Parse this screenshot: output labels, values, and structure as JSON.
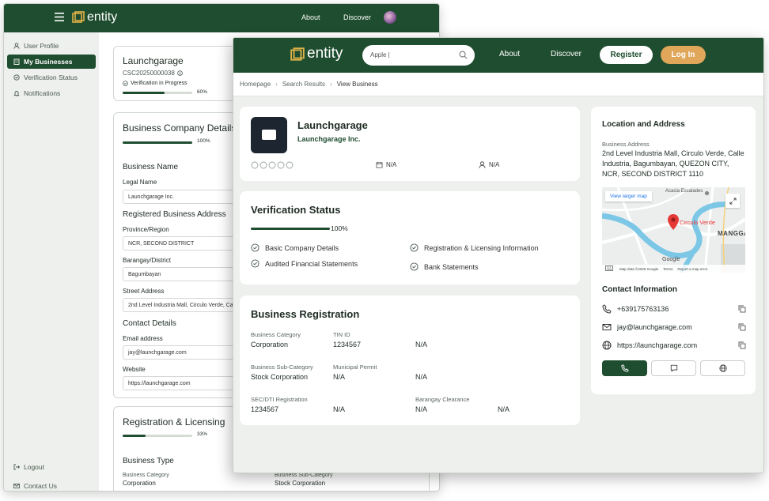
{
  "back_window": {
    "brand": "entity",
    "nav": {
      "about": "About",
      "discover": "Discover"
    },
    "sidebar": {
      "items": [
        {
          "label": "User Profile",
          "icon": "user-icon"
        },
        {
          "label": "My Businesses",
          "icon": "building-icon"
        },
        {
          "label": "Verification Status",
          "icon": "shield-icon"
        },
        {
          "label": "Notifications",
          "icon": "bell-icon"
        }
      ],
      "logout": "Logout",
      "contact_us": "Contact Us"
    },
    "business": {
      "name": "Launchgarage",
      "code": "CSC20250000038",
      "status": "Verification in Progress",
      "progress_pct": 60,
      "progress_label": "60%"
    },
    "company_details": {
      "title": "Business Company Details",
      "progress_pct": 100,
      "progress_label": "100%",
      "business_name_heading": "Business Name",
      "legal_name_label": "Legal Name",
      "legal_name_value": "Launchgarage Inc.",
      "address_heading": "Registered Business Address",
      "province_label": "Province/Region",
      "province_value": "NCR, SECOND DISTRICT",
      "barangay_label": "Barangay/District",
      "barangay_value": "Bagumbayan",
      "street_label": "Street Address",
      "street_value": "2nd Level Industria Mall, Circulo Verde, Ca",
      "contact_heading": "Contact Details",
      "email_label": "Email address",
      "email_value": "jay@launchgarage.com",
      "website_label": "Website",
      "website_value": "https://launchgarage.com"
    },
    "licensing": {
      "title": "Registration & Licensing",
      "progress_pct": 33,
      "progress_label": "33%",
      "type_heading": "Business Type",
      "category_label": "Business Category",
      "category_value": "Corporation",
      "subcategory_label": "Business Sub-Category",
      "subcategory_value": "Stock Corporation"
    }
  },
  "front_window": {
    "brand": "entity",
    "search": {
      "value": "Apple |"
    },
    "nav": {
      "about": "About",
      "discover": "Discover",
      "register": "Register",
      "login": "Log In"
    },
    "breadcrumb": [
      "Homepage",
      "Search Results",
      "View Business"
    ],
    "business": {
      "name": "Launchgarage",
      "legal_name": "Launchgarage Inc.",
      "rating": 0,
      "date": "N/A",
      "person": "N/A"
    },
    "verification": {
      "title": "Verification Status",
      "progress_pct": 100,
      "progress_label": "100%",
      "items": [
        "Basic Company Details",
        "Registration & Licensing Information",
        "Audited Financial Statements",
        "Bank Statements"
      ]
    },
    "registration": {
      "title": "Business Registration",
      "category_label": "Business Category",
      "category_value": "Corporation",
      "tin_label": "TIN ID",
      "tin_value": "1234567",
      "col3_row1_value": "N/A",
      "subcategory_label": "Business Sub-Category",
      "subcategory_value": "Stock Corporation",
      "permit_label": "Municipal Permit",
      "permit_value": "N/A",
      "col3_row2_value": "N/A",
      "sec_label": "SEC/DTI Registration",
      "sec_value": "1234567",
      "col2_row3_value": "N/A",
      "clearance_label": "Barangay Clearance",
      "clearance_value": "N/A",
      "col4_row3_value": "N/A"
    },
    "location": {
      "title": "Location and Address",
      "address_label": "Business Address",
      "address_value": "2nd Level Industria Mall, Circulo Verde, Calle Industria, Bagumbayan, QUEZON CITY, NCR, SECOND DISTRICT 1110",
      "map": {
        "view_larger": "View larger map",
        "place": "Circulo Verde",
        "area": "MANGGAH",
        "street": "Acacia Escalades",
        "google": "Google",
        "footer": [
          "Map data ©2025 Google",
          "Terms",
          "Report a map error"
        ]
      }
    },
    "contact": {
      "title": "Contact Information",
      "phone": "+639175763136",
      "email": "jay@launchgarage.com",
      "website": "https://launchgarage.com"
    },
    "colors": {
      "primary": "#1f4d2f",
      "accent": "#e0a65a",
      "map_water": "#7cc7e6",
      "pin": "#e53935"
    }
  }
}
